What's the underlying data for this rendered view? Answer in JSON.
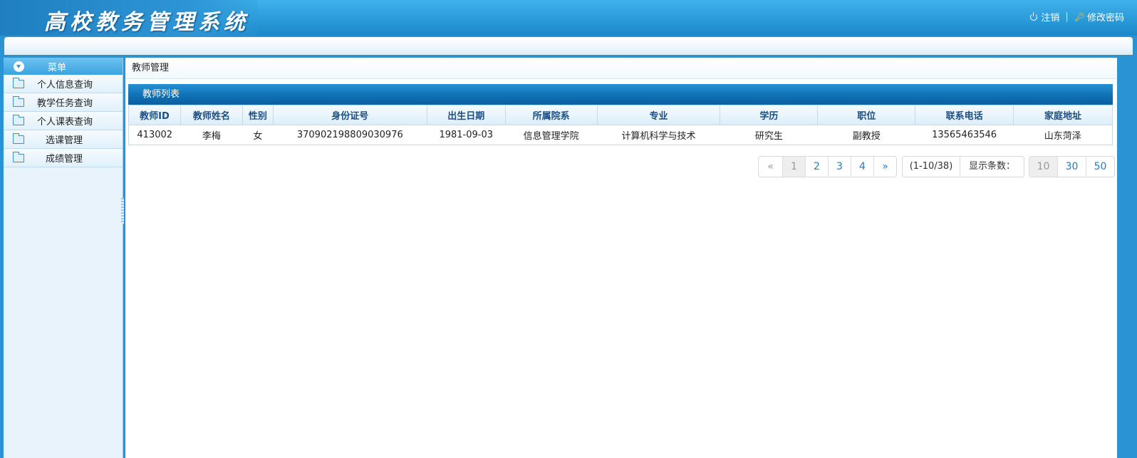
{
  "app": {
    "title": "高校教务管理系统"
  },
  "header": {
    "logout_label": "注销",
    "separator": "|",
    "change_password_label": "修改密码"
  },
  "sidebar": {
    "menu_title": "菜单",
    "items": [
      {
        "label": "个人信息查询"
      },
      {
        "label": "教学任务查询"
      },
      {
        "label": "个人课表查询"
      },
      {
        "label": "选课管理"
      },
      {
        "label": "成绩管理"
      }
    ]
  },
  "content": {
    "breadcrumb": "教师管理",
    "list_title": "教师列表"
  },
  "table": {
    "columns": [
      "教师ID",
      "教师姓名",
      "性别",
      "身份证号",
      "出生日期",
      "所属院系",
      "专业",
      "学历",
      "职位",
      "联系电话",
      "家庭地址"
    ],
    "rows": [
      [
        "413002",
        "李梅",
        "女",
        "370902198809030976",
        "1981-09-03",
        "信息管理学院",
        "计算机科学与技术",
        "研究生",
        "副教授",
        "13565463546",
        "山东菏泽"
      ]
    ]
  },
  "pagination": {
    "prev": "«",
    "pages": [
      "1",
      "2",
      "3",
      "4"
    ],
    "current": "1",
    "next": "»",
    "range": "(1-10/38)",
    "page_size_label": "显示条数：",
    "page_sizes": [
      "10",
      "30",
      "50"
    ],
    "current_page_size": "10"
  }
}
